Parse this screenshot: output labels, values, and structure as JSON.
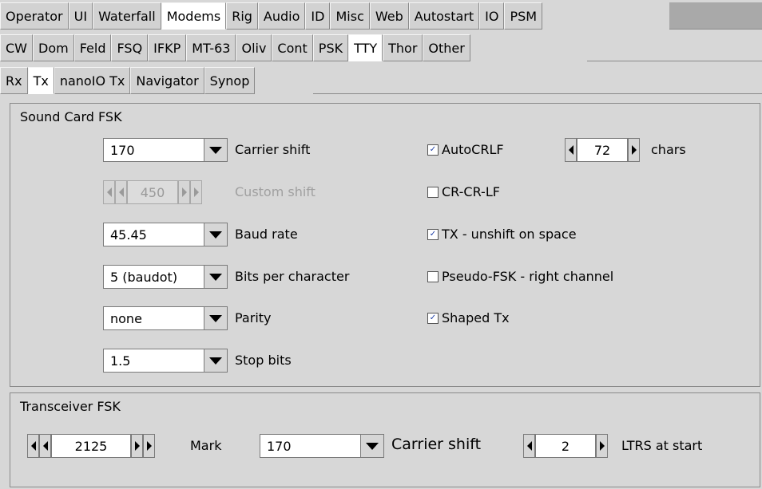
{
  "tabs": {
    "main": [
      "Operator",
      "UI",
      "Waterfall",
      "Modems",
      "Rig",
      "Audio",
      "ID",
      "Misc",
      "Web",
      "Autostart",
      "IO",
      "PSM"
    ],
    "modems": [
      "CW",
      "Dom",
      "Feld",
      "FSQ",
      "IFKP",
      "MT-63",
      "Oliv",
      "Cont",
      "PSK",
      "TTY",
      "Thor",
      "Other"
    ],
    "tty": [
      "Rx",
      "Tx",
      "nanoIO Tx",
      "Navigator",
      "Synop"
    ]
  },
  "sound_card": {
    "title": "Sound Card FSK",
    "carrier_shift": {
      "value": "170",
      "label": "Carrier shift"
    },
    "custom_shift": {
      "value": "450",
      "label": "Custom shift"
    },
    "baud_rate": {
      "value": "45.45",
      "label": "Baud rate"
    },
    "bits_per_char": {
      "value": "5 (baudot)",
      "label": "Bits per character"
    },
    "parity": {
      "value": "none",
      "label": "Parity"
    },
    "stop_bits": {
      "value": "1.5",
      "label": "Stop bits"
    },
    "autocrlf": {
      "label": "AutoCRLF",
      "checked": true
    },
    "chars": {
      "value": "72",
      "label": "chars"
    },
    "cr_cr_lf": {
      "label": "CR-CR-LF",
      "checked": false
    },
    "tx_unshift": {
      "label": "TX - unshift on space",
      "checked": true
    },
    "pseudo_fsk": {
      "label": "Pseudo-FSK - right channel",
      "checked": false
    },
    "shaped_tx": {
      "label": "Shaped Tx",
      "checked": true
    }
  },
  "transceiver": {
    "title": "Transceiver FSK",
    "mark": {
      "value": "2125",
      "label": "Mark"
    },
    "carrier_shift": {
      "value": "170",
      "label": "Carrier shift"
    },
    "ltrs": {
      "value": "2",
      "label": "LTRS at start"
    }
  },
  "check_glyph": "✓"
}
